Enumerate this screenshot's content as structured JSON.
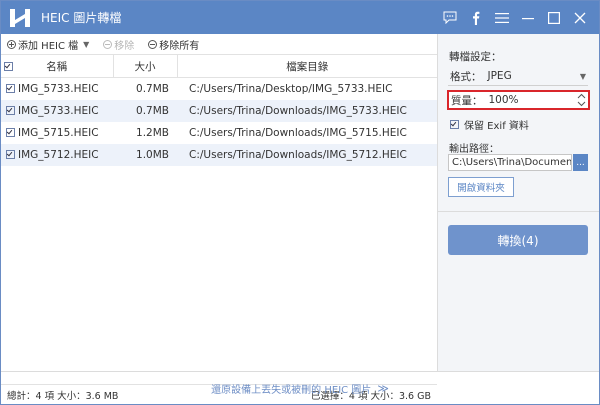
{
  "app": {
    "title": "HEIC 圖片轉檔"
  },
  "toolbar": {
    "add_label": "添加 HEIC 檔",
    "remove_label": "移除",
    "remove_all_label": "移除所有"
  },
  "table": {
    "columns": [
      "名稱",
      "大小",
      "檔案目錄"
    ],
    "rows": [
      {
        "name": "IMG_5733.HEIC",
        "size": "0.7MB",
        "path": "C:/Users/Trina/Desktop/IMG_5733.HEIC"
      },
      {
        "name": "IMG_5733.HEIC",
        "size": "0.7MB",
        "path": "C:/Users/Trina/Downloads/IMG_5733.HEIC"
      },
      {
        "name": "IMG_5715.HEIC",
        "size": "1.2MB",
        "path": "C:/Users/Trina/Downloads/IMG_5715.HEIC"
      },
      {
        "name": "IMG_5712.HEIC",
        "size": "1.0MB",
        "path": "C:/Users/Trina/Downloads/IMG_5712.HEIC"
      }
    ]
  },
  "status": {
    "total": "總計：4 項 大小：3.6 MB",
    "selected": "已選擇：4 項 大小：3.6 GB"
  },
  "settings": {
    "title": "轉檔設定：",
    "format_label": "格式：",
    "format_value": "JPEG",
    "quality_label": "質量：",
    "quality_value": "100%",
    "exif_label": "保留 Exif 資料",
    "exif_checked": true,
    "output_label": "輸出路徑：",
    "output_path": "C:\\Users\\Trina\\Documents\\",
    "browse_label": "...",
    "open_folder_label": "開啟資料夾",
    "convert_label": "轉換(4)"
  },
  "footer": {
    "link_label": "還原設備上丟失或被刪的 HEIC 圖片",
    "arrows": "≫"
  },
  "colors": {
    "titlebar": "#5b86c5",
    "accent": "#6f93cc",
    "highlight_border": "#d9262b"
  }
}
